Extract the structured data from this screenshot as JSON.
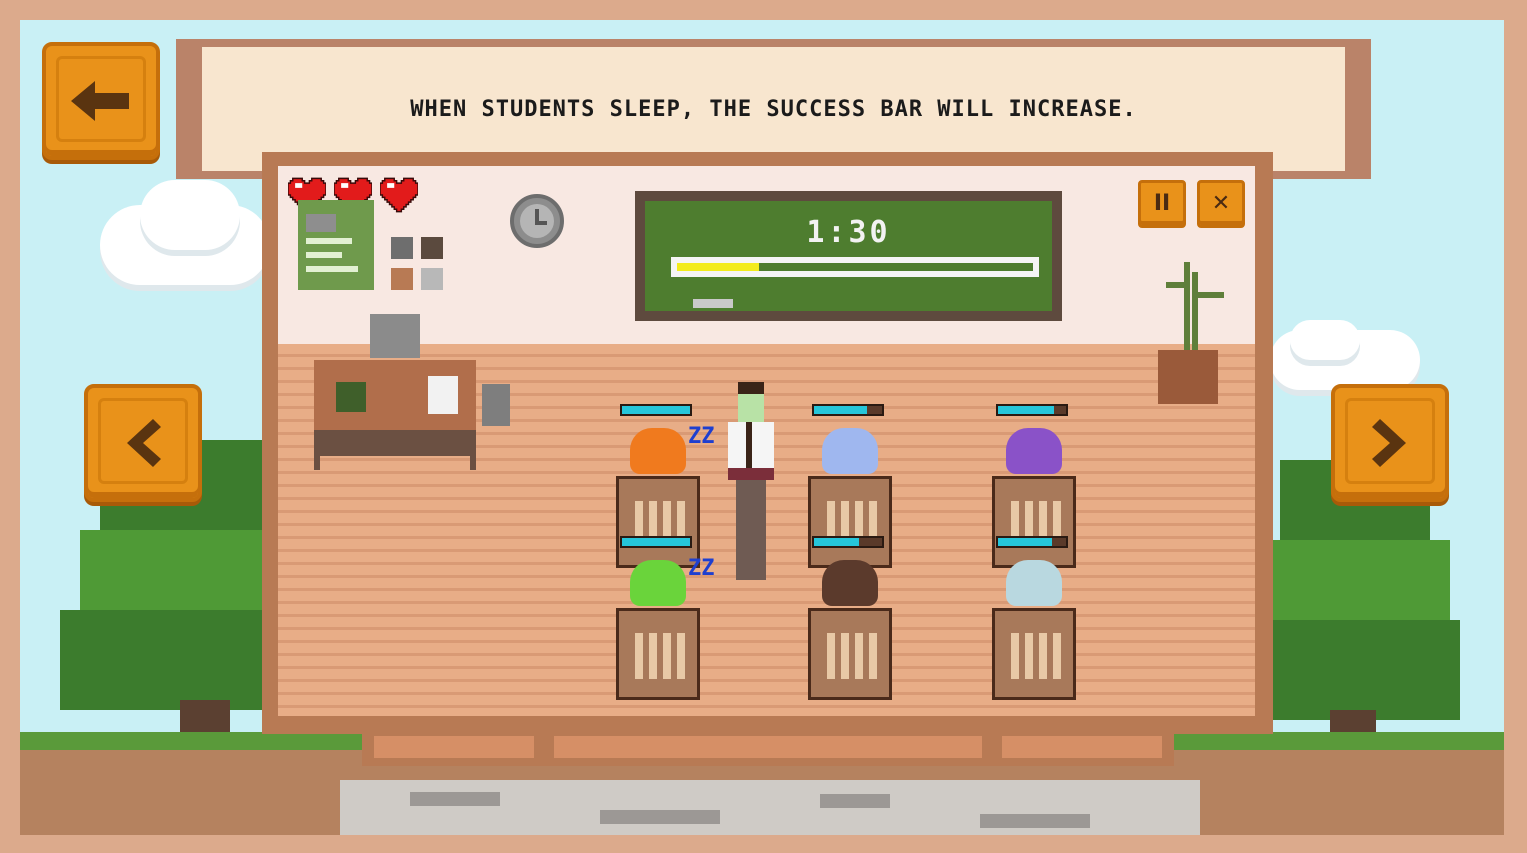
{
  "banner": {
    "text": "WHEN STUDENTS SLEEP, THE SUCCESS BAR WILL INCREASE."
  },
  "hud": {
    "lives": 3,
    "timer": "1:30",
    "success_progress": 0.23,
    "pause_glyph": "II",
    "close_glyph": "✕"
  },
  "icons": {
    "back": "back-arrow-icon",
    "prev": "chevron-left-icon",
    "next": "chevron-right-icon",
    "clock": "clock-icon",
    "heart": "heart-icon"
  },
  "students": [
    {
      "row": 1,
      "col": 1,
      "hair_color": "#f07a1e",
      "energy": 1.0,
      "sleeping": true,
      "zz": "ZZ"
    },
    {
      "row": 1,
      "col": 2,
      "hair_color": "#9fb7ef",
      "energy": 0.78,
      "sleeping": false,
      "zz": ""
    },
    {
      "row": 1,
      "col": 3,
      "hair_color": "#8a52c8",
      "energy": 0.82,
      "sleeping": false,
      "zz": ""
    },
    {
      "row": 2,
      "col": 1,
      "hair_color": "#6ad43b",
      "energy": 1.0,
      "sleeping": true,
      "zz": "ZZ"
    },
    {
      "row": 2,
      "col": 2,
      "hair_color": "#5b3a2c",
      "energy": 0.66,
      "sleeping": false,
      "zz": ""
    },
    {
      "row": 2,
      "col": 3,
      "hair_color": "#b9d8e0",
      "energy": 0.8,
      "sleeping": false,
      "zz": ""
    }
  ],
  "colors": {
    "accent": "#e9921a",
    "success_bar": "#f3ec1d",
    "energy_bar": "#26c6da",
    "chalkboard": "#4e7d2f",
    "heart": "#e21b1b",
    "zz": "#1e3fcf"
  }
}
